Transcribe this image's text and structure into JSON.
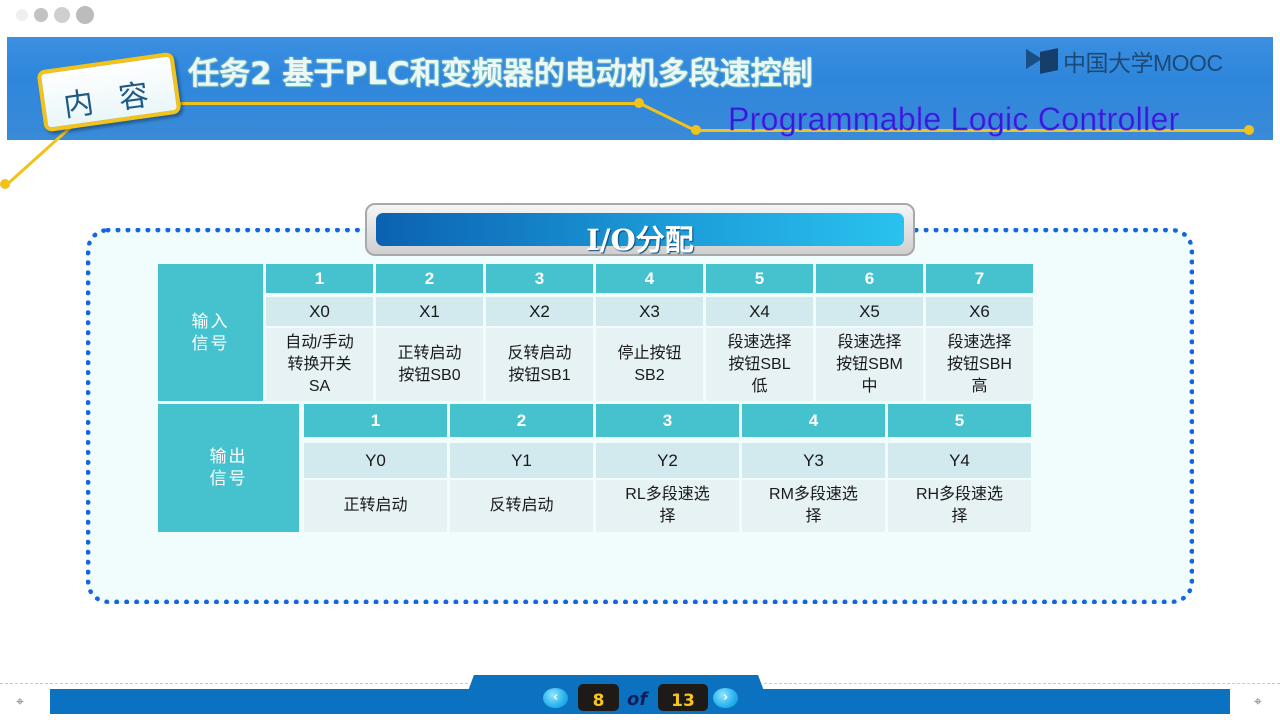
{
  "header": {
    "tag_label": "内 容",
    "title": "任务2 基于PLC和变频器的电动机多段速控制",
    "subtitle": "Programmable Logic Controller",
    "logo_text": "中国大学MOOC"
  },
  "section": {
    "heading": "I/O分配"
  },
  "input_table": {
    "label": "输入\n信号",
    "columns": [
      {
        "index": "1",
        "address": "X0",
        "description": "自动/手动\n转换开关\nSA"
      },
      {
        "index": "2",
        "address": "X1",
        "description": "正转启动\n按钮SB0"
      },
      {
        "index": "3",
        "address": "X2",
        "description": "反转启动\n按钮SB1"
      },
      {
        "index": "4",
        "address": "X3",
        "description": "停止按钮\nSB2"
      },
      {
        "index": "5",
        "address": "X4",
        "description": "段速选择\n按钮SBL\n低"
      },
      {
        "index": "6",
        "address": "X5",
        "description": "段速选择\n按钮SBM\n中"
      },
      {
        "index": "7",
        "address": "X6",
        "description": "段速选择\n按钮SBH\n高"
      }
    ]
  },
  "output_table": {
    "label": "输出\n信号",
    "columns": [
      {
        "index": "1",
        "address": "Y0",
        "description": "正转启动"
      },
      {
        "index": "2",
        "address": "Y1",
        "description": "反转启动"
      },
      {
        "index": "3",
        "address": "Y2",
        "description": "RL多段速选\n择"
      },
      {
        "index": "4",
        "address": "Y3",
        "description": "RM多段速选\n择"
      },
      {
        "index": "5",
        "address": "Y4",
        "description": "RH多段速选\n择"
      }
    ]
  },
  "pagination": {
    "prev_icon": "‹",
    "next_icon": "›",
    "current_page": "8",
    "separator": "of",
    "total_pages": "13"
  },
  "icons": {
    "crosshair": "⌖"
  }
}
